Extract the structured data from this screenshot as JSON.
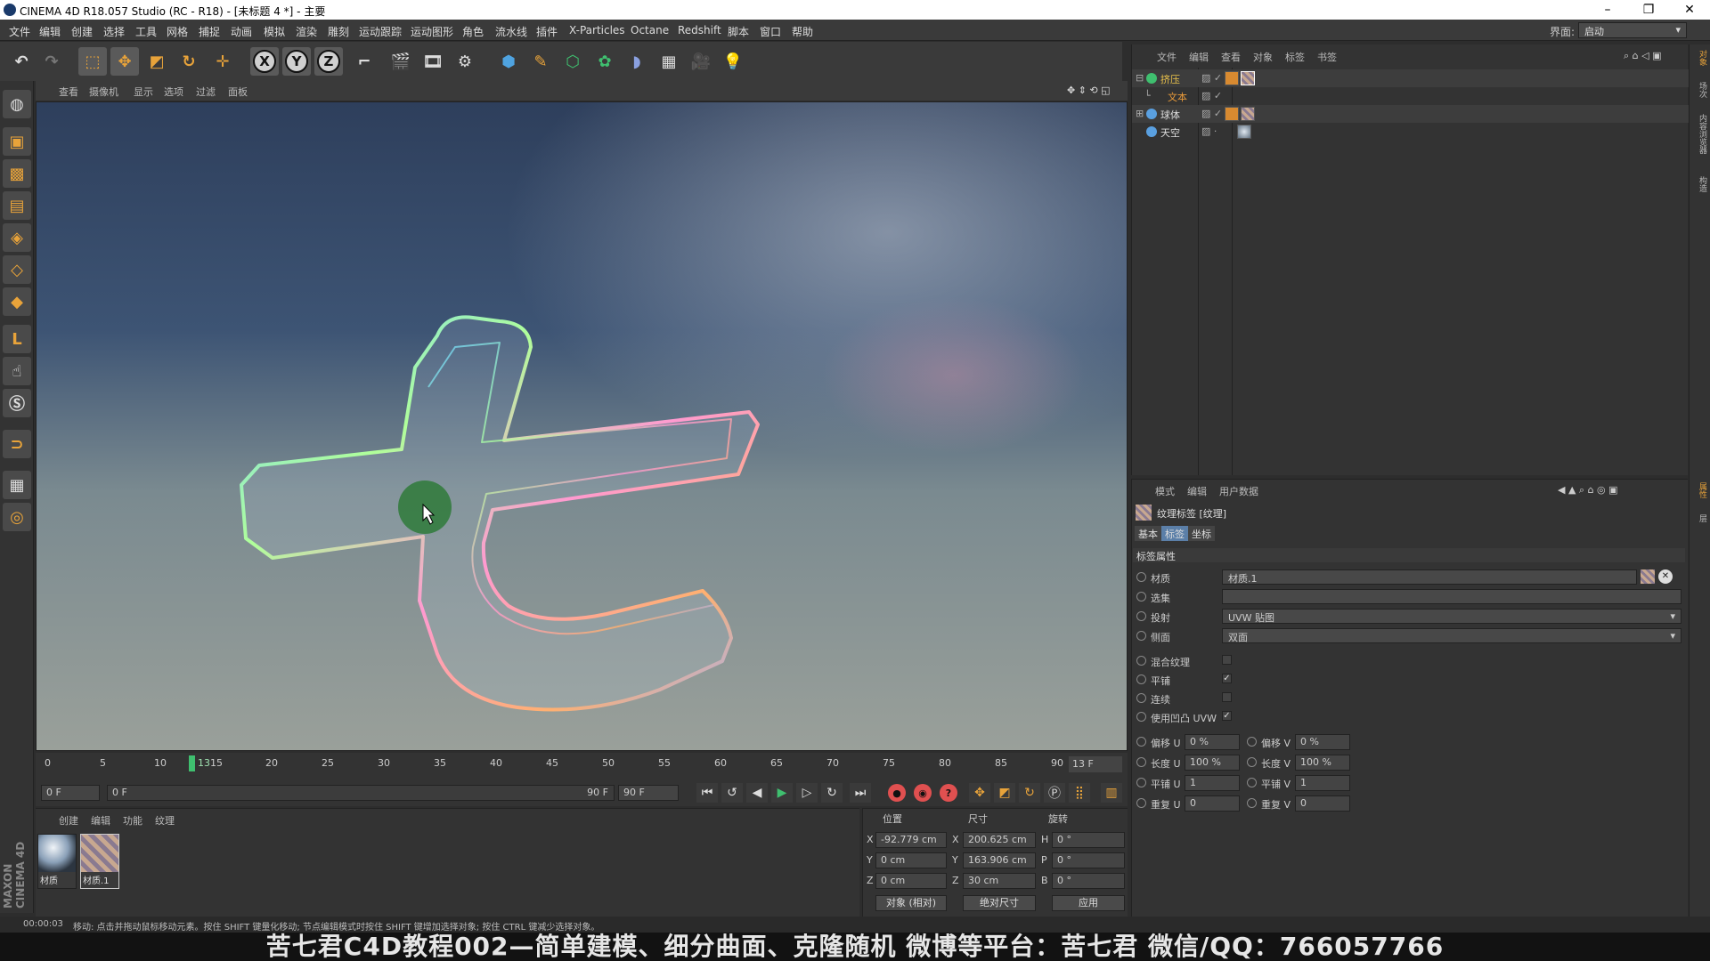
{
  "titlebar": {
    "title": "CINEMA 4D R18.057 Studio (RC - R18) - [未标题 4 *] - 主要",
    "min": "–",
    "max": "❐",
    "close": "✕"
  },
  "menu": [
    "文件",
    "编辑",
    "创建",
    "选择",
    "工具",
    "网格",
    "捕捉",
    "动画",
    "模拟",
    "渲染",
    "雕刻",
    "运动跟踪",
    "运动图形",
    "角色",
    "流水线",
    "插件",
    "X-Particles",
    "Octane",
    "Redshift",
    "脚本",
    "窗口",
    "帮助"
  ],
  "layout": {
    "label": "界面:",
    "value": "启动"
  },
  "viewport_menu": [
    "查看",
    "摄像机",
    "显示",
    "选项",
    "过滤",
    "面板"
  ],
  "axes": [
    "X",
    "Y",
    "Z"
  ],
  "timeline": {
    "ticks": [
      "0",
      "5",
      "10",
      "15",
      "20",
      "25",
      "30",
      "35",
      "40",
      "45",
      "50",
      "55",
      "60",
      "65",
      "70",
      "75",
      "80",
      "85",
      "90"
    ],
    "current_marker": "13",
    "current_frame_field": "13 F"
  },
  "playbar": {
    "start": "0 F",
    "range_start": "0 F",
    "range_end": "90 F",
    "end": "90 F"
  },
  "materials": {
    "menu": [
      "创建",
      "编辑",
      "功能",
      "纹理"
    ],
    "items": [
      {
        "name": "材质"
      },
      {
        "name": "材质.1"
      }
    ]
  },
  "coords": {
    "headers": {
      "pos": "位置",
      "size": "尺寸",
      "rot": "旋转"
    },
    "rows": [
      {
        "axis": "X",
        "pos": "-92.779 cm",
        "saxis": "X",
        "size": "200.625 cm",
        "raxis": "H",
        "rot": "0 °"
      },
      {
        "axis": "Y",
        "pos": "0 cm",
        "saxis": "Y",
        "size": "163.906 cm",
        "raxis": "P",
        "rot": "0 °"
      },
      {
        "axis": "Z",
        "pos": "0 cm",
        "saxis": "Z",
        "size": "30 cm",
        "raxis": "B",
        "rot": "0 °"
      }
    ],
    "mode": "对象 (相对)",
    "sizemode": "绝对尺寸",
    "apply": "应用"
  },
  "objects": {
    "menu": [
      "文件",
      "编辑",
      "查看",
      "对象",
      "标签",
      "书签"
    ],
    "rows": [
      {
        "name": "挤压",
        "color": "#e8c04a"
      },
      {
        "name": "文本",
        "color": "#e89a3a"
      },
      {
        "name": "球体",
        "color": "#cfcfcf"
      },
      {
        "name": "天空",
        "color": "#cfcfcf"
      }
    ]
  },
  "attributes": {
    "menu": [
      "模式",
      "编辑",
      "用户数据"
    ],
    "title": "纹理标签 [纹理]",
    "tabs": [
      "基本",
      "标签",
      "坐标"
    ],
    "section": "标签属性",
    "material_label": "材质",
    "material_value": "材质.1",
    "selection_label": "选集",
    "projection_label": "投射",
    "projection_value": "UVW 贴图",
    "side_label": "侧面",
    "side_value": "双面",
    "mix_label": "混合纹理",
    "tile_label": "平铺",
    "seamless_label": "连续",
    "bump_label": "使用凹凸 UVW",
    "offset_u": {
      "label": "偏移 U",
      "value": "0 %"
    },
    "offset_v": {
      "label": "偏移 V",
      "value": "0 %"
    },
    "length_u": {
      "label": "长度 U",
      "value": "100 %"
    },
    "length_v": {
      "label": "长度 V",
      "value": "100 %"
    },
    "tiles_u": {
      "label": "平铺 U",
      "value": "1"
    },
    "tiles_v": {
      "label": "平铺 V",
      "value": "1"
    },
    "repeat_u": {
      "label": "重复 U",
      "value": "0"
    },
    "repeat_v": {
      "label": "重复 V",
      "value": "0"
    }
  },
  "status": {
    "time": "00:00:03",
    "message": "移动: 点击并拖动鼠标移动元素。按住 SHIFT 键量化移动; 节点编辑模式时按住 SHIFT 键增加选择对象; 按住 CTRL 键减少选择对象。"
  },
  "caption": "苦七君C4D教程002—简单建模、细分曲面、克隆随机   微博等平台：苦七君   微信/QQ：766057766",
  "brand": "MAXON CINEMA 4D",
  "right_strip": [
    "对象",
    "场次",
    "内容浏览器",
    "构造",
    "属性",
    "层"
  ]
}
